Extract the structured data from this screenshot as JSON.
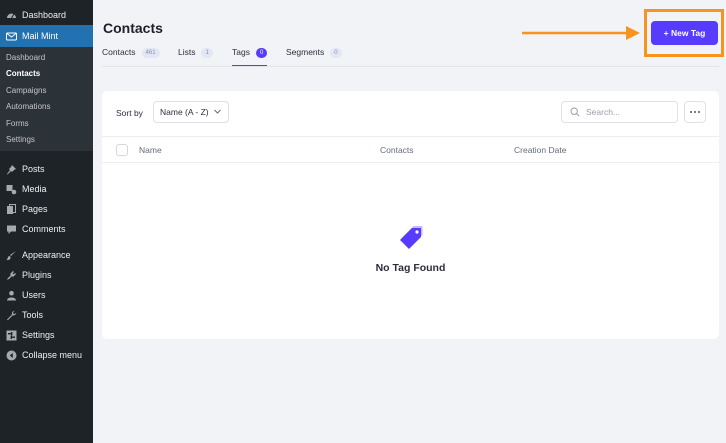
{
  "sidebar": {
    "items": [
      {
        "label": "Dashboard",
        "icon": "dashboard-icon"
      },
      {
        "label": "Mail Mint",
        "icon": "mail-icon"
      },
      {
        "label": "Posts",
        "icon": "pin-icon"
      },
      {
        "label": "Media",
        "icon": "media-icon"
      },
      {
        "label": "Pages",
        "icon": "pages-icon"
      },
      {
        "label": "Comments",
        "icon": "comment-icon"
      },
      {
        "label": "Appearance",
        "icon": "brush-icon"
      },
      {
        "label": "Plugins",
        "icon": "plug-icon"
      },
      {
        "label": "Users",
        "icon": "user-icon"
      },
      {
        "label": "Tools",
        "icon": "wrench-icon"
      },
      {
        "label": "Settings",
        "icon": "settings-icon"
      },
      {
        "label": "Collapse menu",
        "icon": "collapse-icon"
      }
    ],
    "submenu": [
      "Dashboard",
      "Contacts",
      "Campaigns",
      "Automations",
      "Forms",
      "Settings"
    ],
    "active_item": "Mail Mint",
    "current_submenu": "Contacts"
  },
  "page": {
    "title": "Contacts",
    "new_tag_button": "+ New Tag"
  },
  "tabs": [
    {
      "label": "Contacts",
      "count": "461"
    },
    {
      "label": "Lists",
      "count": "1"
    },
    {
      "label": "Tags",
      "count": "0"
    },
    {
      "label": "Segments",
      "count": "0"
    }
  ],
  "active_tab": "Tags",
  "toolbar": {
    "sort_label": "Sort by",
    "sort_value": "Name (A - Z)",
    "search_placeholder": "Search..."
  },
  "table": {
    "columns": [
      "Name",
      "Contacts",
      "Creation Date"
    ]
  },
  "empty_state": {
    "message": "No Tag Found"
  },
  "colors": {
    "sidebar_bg": "#1d2327",
    "wp_active": "#2271b1",
    "brand": "#573bff",
    "highlight": "#f7941d"
  }
}
